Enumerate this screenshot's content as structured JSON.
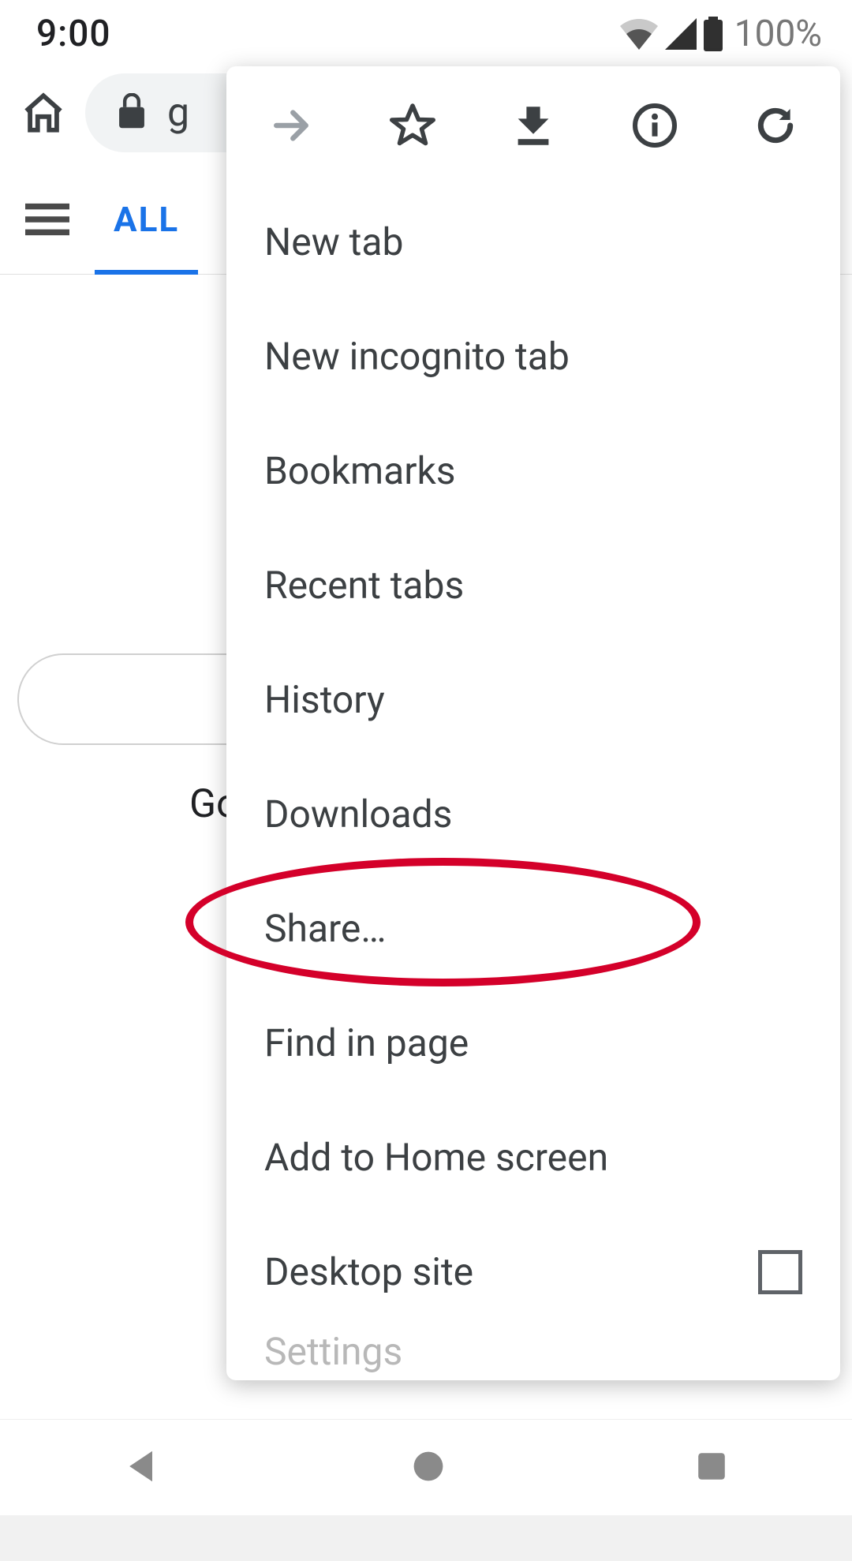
{
  "status": {
    "time": "9:00",
    "battery_pct": "100%"
  },
  "toolbar": {
    "url_fragment": "g"
  },
  "page": {
    "tab_all": "ALL",
    "partial_text": "Go"
  },
  "menu": {
    "items": [
      {
        "label": "New tab"
      },
      {
        "label": "New incognito tab"
      },
      {
        "label": "Bookmarks"
      },
      {
        "label": "Recent tabs"
      },
      {
        "label": "History"
      },
      {
        "label": "Downloads"
      },
      {
        "label": "Share…"
      },
      {
        "label": "Find in page"
      },
      {
        "label": "Add to Home screen"
      },
      {
        "label": "Desktop site",
        "has_checkbox": true
      },
      {
        "label": "Settings",
        "cut": true
      }
    ]
  },
  "colors": {
    "accent": "#1a73e8",
    "annotation": "#d4002a"
  }
}
